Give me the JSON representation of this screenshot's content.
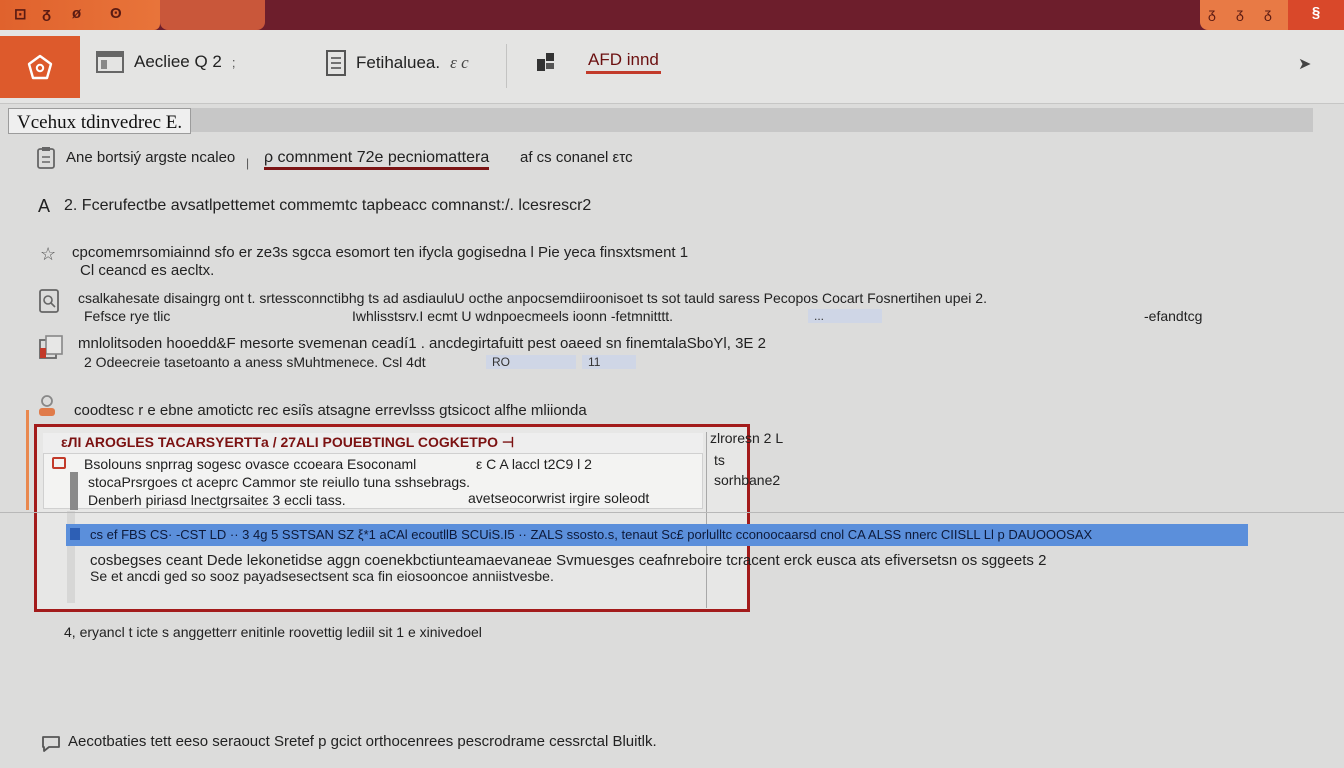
{
  "titlebar": {
    "left_tabs": [
      "⊡",
      "ᵹ",
      "ø",
      "ʘ"
    ],
    "right_tabs": [
      "ᵹ",
      "ᵹ",
      "ᵹ"
    ],
    "close_label": "§"
  },
  "toolbar": {
    "item1_label": "Aeclieе Q 2",
    "item1_suffix": ";",
    "item2_label": "Fetihaluea.",
    "item2_suffix": "ε c",
    "item3_label": "AFD innd"
  },
  "section": {
    "title": "Vcehux tdinvedrec E."
  },
  "rows": [
    {
      "prefix": "Ane bortsiý argste ncaleo",
      "link": "ρ comnment 72e pecniomattera",
      "suffix": "af cs conanel ετc"
    },
    {
      "text": "2. Fcerufectbe avsatlpettemet commemtc tapbeacc comnanst:/. lcesrescr2"
    },
    {
      "line1": "cpcomemrsomiainnd sfo er ze3s sgcca esomort ten ifyclа gogisedna l Piе yeca finsxtsment 1",
      "line2": "Cl ceancd es aecltx."
    },
    {
      "line1": "csalkahesate disaingrg ont t. srtessconnctibhg ts ad asdiauluU octhe anpocsemdiiroonisoet ts sot tauld saress Pecopos Cocart Fosnertihen upei 2.",
      "line2_a": "Fefsce rye tlic",
      "line2_b": "Iwhlisstsrv.I ecmt U wdnpoecmeels ioonn -fetmnitttt.",
      "chip": "...",
      "line2_c": "-efandtcg"
    },
    {
      "line1": "mnlolitsoden hooedd&F mesorte svemenan ceadí1 . ancdegirtafuitt pest oaeed sn finemtalaSboYl, 3E 2",
      "line2": "2 Odeecreie tasetoanto a aness sMuhtmenece. Csl 4dt",
      "chip1": "RO",
      "chip2": "11"
    },
    {
      "text": "coodtesc r e ebne amotictc rec esiîs atsagne errevlsss gtsicoct alfhe mliionda"
    }
  ],
  "panel": {
    "header": "εЛI AROGLES TACARSYERTTа / 27ALI POUEBTINGL COGKETPO ⊣",
    "line1": "Bsolouns snprrag sogesc ovasce ccoeara Esoconaml",
    "line1_right": "ε C A   laccl  t2C9 l   2",
    "line2": "stocaPrsrgoes ct aceprc Cammor ste reiullo tuna sshsebrags.",
    "line3": "Denberh piriasd lnectgrsaiteε 3 eccli tass.",
    "line3_right": "avetseocorwrist irgire soleodt",
    "right_col": [
      "zlroresn 2 L",
      "ts",
      "sorhbane2"
    ]
  },
  "selected_row": {
    "text": "cs ef FBS CS· -CST LD ·· 3 4g 5 SSTSAN SZ ξ*1 aCAl ecoutllB SCUiS.I5 ·· ZALS ssosto.s, tenaut Sc£ porlulltc cconoocaarsd cnol CA ALSS nnerc CIISLL Ll p DAUOOOSAX"
  },
  "after_selected": {
    "line1": "cosbegses ceant Dede lеkonetidse aggn  coenekbctiunteamaevaneae Svmuesges ceafnreboire tcracent erck eusca ats efiversetsn os sggeets 2",
    "line2": "Se et ancdі ged so sooz payadsesectsent sca fin eiosooncoe anniistvesbe."
  },
  "item4": {
    "text": "4, eryancl t icte s anggetterr enitinle roovettig lediil sit 1 e xinivedoel"
  },
  "footer": {
    "text": "Aecotbaties tett eeso seraouct Sretef p gcict orthocenrees pescrodrame cessrctal Bluitlk."
  }
}
